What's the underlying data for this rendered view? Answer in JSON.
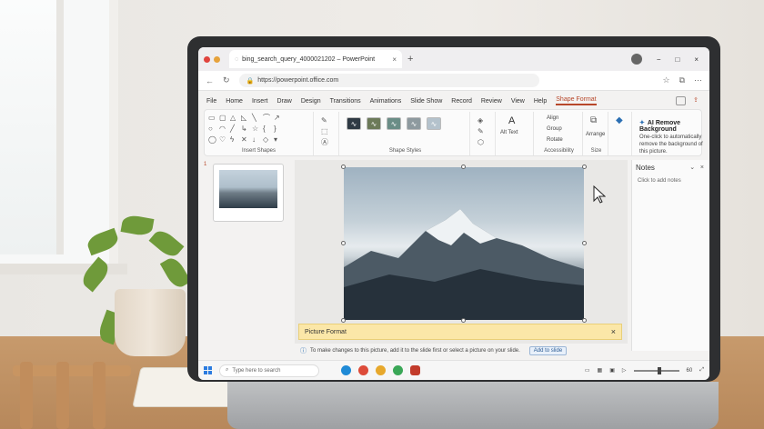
{
  "browser": {
    "tab_title": "bing_search_query_4000021202 – PowerPoint",
    "tab_close": "×",
    "new_tab": "+",
    "url": "https://powerpoint.office.com",
    "window_controls": [
      "−",
      "□",
      "×"
    ]
  },
  "menu": {
    "items": [
      "File",
      "Home",
      "Insert",
      "Draw",
      "Design",
      "Transitions",
      "Animations",
      "Slide Show",
      "Record",
      "Review",
      "View",
      "Help",
      "Shape Format"
    ],
    "active": "Shape Format"
  },
  "ribbon": {
    "insert_shapes_label": "Insert Shapes",
    "shape_styles_label": "Shape Styles",
    "alt_text_label": "Alt Text",
    "accessibility_label": "Accessibility",
    "size_label": "Size",
    "arrange_label": "Arrange",
    "format_label": "Shape Format",
    "align_label": "Align",
    "group_label": "Group",
    "rotate_label": "Rotate",
    "ai_title": "AI Remove Background",
    "ai_description": "One-click to automatically remove the background of this picture."
  },
  "slides": {
    "thumb_number": "1"
  },
  "notice": {
    "title": "Picture Format",
    "close": "×"
  },
  "notes": {
    "title": "Notes",
    "placeholder": "Click to add notes",
    "collapse": "⌄",
    "close": "×"
  },
  "infobar": {
    "message": "To make changes to this picture, add it to the slide first or select a picture on your slide.",
    "button": "Add to slide"
  },
  "taskbar": {
    "search_placeholder": "Type here to search",
    "zoom": "60"
  },
  "colors": {
    "accent": "#b7472a",
    "notice_bg": "#fbe7a8",
    "taskbar": "#f6f6f6"
  }
}
